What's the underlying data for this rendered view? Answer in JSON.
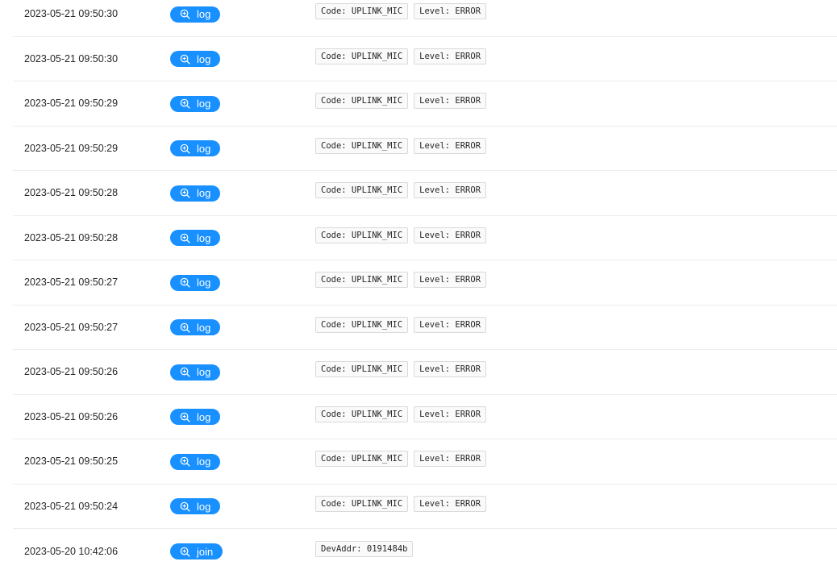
{
  "colors": {
    "accent": "#1890ff",
    "row_divider": "#ececec",
    "tag_border": "#d9d9d9"
  },
  "events": [
    {
      "time": "2023-05-21 09:50:30",
      "action": "log",
      "icon": "zoom-in-icon",
      "tags": [
        "Code: UPLINK_MIC",
        "Level: ERROR"
      ]
    },
    {
      "time": "2023-05-21 09:50:30",
      "action": "log",
      "icon": "zoom-in-icon",
      "tags": [
        "Code: UPLINK_MIC",
        "Level: ERROR"
      ]
    },
    {
      "time": "2023-05-21 09:50:29",
      "action": "log",
      "icon": "zoom-in-icon",
      "tags": [
        "Code: UPLINK_MIC",
        "Level: ERROR"
      ]
    },
    {
      "time": "2023-05-21 09:50:29",
      "action": "log",
      "icon": "zoom-in-icon",
      "tags": [
        "Code: UPLINK_MIC",
        "Level: ERROR"
      ]
    },
    {
      "time": "2023-05-21 09:50:28",
      "action": "log",
      "icon": "zoom-in-icon",
      "tags": [
        "Code: UPLINK_MIC",
        "Level: ERROR"
      ]
    },
    {
      "time": "2023-05-21 09:50:28",
      "action": "log",
      "icon": "zoom-in-icon",
      "tags": [
        "Code: UPLINK_MIC",
        "Level: ERROR"
      ]
    },
    {
      "time": "2023-05-21 09:50:27",
      "action": "log",
      "icon": "zoom-in-icon",
      "tags": [
        "Code: UPLINK_MIC",
        "Level: ERROR"
      ]
    },
    {
      "time": "2023-05-21 09:50:27",
      "action": "log",
      "icon": "zoom-in-icon",
      "tags": [
        "Code: UPLINK_MIC",
        "Level: ERROR"
      ]
    },
    {
      "time": "2023-05-21 09:50:26",
      "action": "log",
      "icon": "zoom-in-icon",
      "tags": [
        "Code: UPLINK_MIC",
        "Level: ERROR"
      ]
    },
    {
      "time": "2023-05-21 09:50:26",
      "action": "log",
      "icon": "zoom-in-icon",
      "tags": [
        "Code: UPLINK_MIC",
        "Level: ERROR"
      ]
    },
    {
      "time": "2023-05-21 09:50:25",
      "action": "log",
      "icon": "zoom-in-icon",
      "tags": [
        "Code: UPLINK_MIC",
        "Level: ERROR"
      ]
    },
    {
      "time": "2023-05-21 09:50:24",
      "action": "log",
      "icon": "zoom-in-icon",
      "tags": [
        "Code: UPLINK_MIC",
        "Level: ERROR"
      ]
    },
    {
      "time": "2023-05-20 10:42:06",
      "action": "join",
      "icon": "zoom-in-icon",
      "tags": [
        "DevAddr: 0191484b"
      ]
    }
  ]
}
